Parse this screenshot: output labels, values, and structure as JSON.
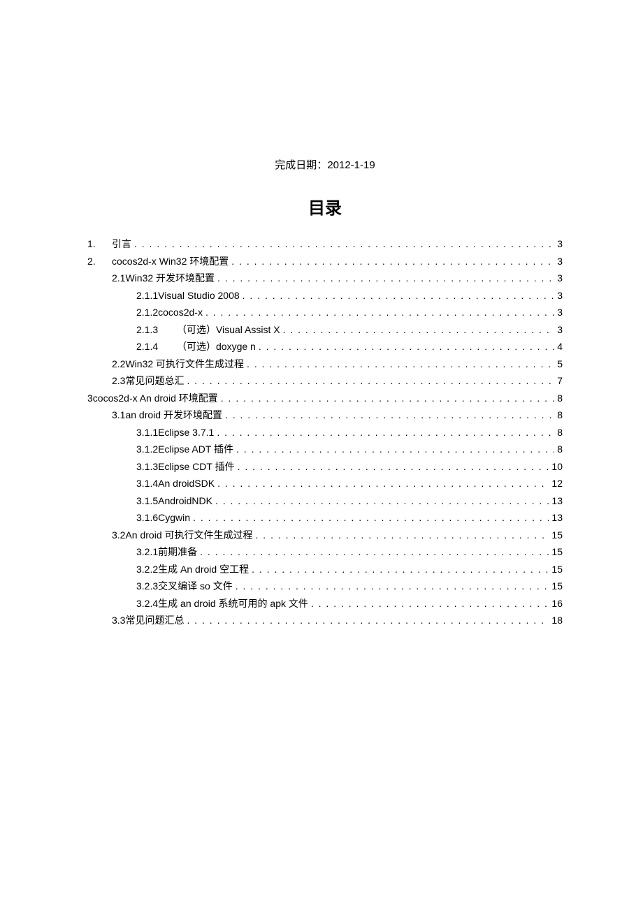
{
  "header": {
    "completion_label": "完成日期：",
    "completion_date": "2012-1-19"
  },
  "toc": {
    "title": "目录",
    "entries": [
      {
        "level": 0,
        "num": "1.",
        "title": "引言",
        "page": "3",
        "num_style": "col"
      },
      {
        "level": 0,
        "num": "2.",
        "title": "cocos2d-x Win32 环境配置",
        "page": "3",
        "num_style": "col"
      },
      {
        "level": 1,
        "num": "2.1",
        "title": " Win32 开发环境配置",
        "page": "3",
        "num_style": "plain"
      },
      {
        "level": 2,
        "num": "2.1.1",
        "title": " Visual Studio 2008",
        "page": " 3",
        "num_style": "plain"
      },
      {
        "level": 2,
        "num": "2.1.2",
        "title": "  cocos2d-x",
        "page": " 3",
        "num_style": "plain"
      },
      {
        "level": 2,
        "num": "2.1.3",
        "title": "（可选）Visual Assist X",
        "page": " 3",
        "num_style": "spaced"
      },
      {
        "level": 2,
        "num": "2.1.4",
        "title": "（可选）doxyge n",
        "page": " 4",
        "num_style": "spaced"
      },
      {
        "level": 1,
        "num": "2.2",
        "title": "  Win32 可执行文件生成过程",
        "page": "5",
        "num_style": "plain"
      },
      {
        "level": 1,
        "num": "2.3",
        "title": " 常见问题总汇",
        "page": "7",
        "num_style": "plain"
      },
      {
        "level": 0,
        "num": "3",
        "title": " cocos2d-x An droid 环境配置",
        "page": "8",
        "num_style": "plain"
      },
      {
        "level": 1,
        "num": "3.1",
        "title": " an droid 开发环境配置",
        "page": "8",
        "num_style": "plain"
      },
      {
        "level": 2,
        "num": "3.1.1",
        "title": " Eclipse 3.7.1",
        "page": " 8",
        "num_style": "plain"
      },
      {
        "level": 2,
        "num": "3.1.2",
        "title": " Eclipse ADT  插件",
        "page": "8",
        "num_style": "plain"
      },
      {
        "level": 2,
        "num": "3.1.3",
        "title": " Eclipse CDT  插件",
        "page": " 10",
        "num_style": "plain"
      },
      {
        "level": 2,
        "num": "3.1.4",
        "title": " An droidSDK",
        "page": " 12",
        "num_style": "plain"
      },
      {
        "level": 2,
        "num": "3.1.5",
        "title": " AndroidNDK",
        "page": " 13",
        "num_style": "plain"
      },
      {
        "level": 2,
        "num": "3.1.6",
        "title": " Cygwin",
        "page": " 13",
        "num_style": "plain"
      },
      {
        "level": 1,
        "num": "3.2",
        "title": "  An droid 可执行文件生成过程",
        "page": "15",
        "num_style": "plain"
      },
      {
        "level": 2,
        "num": "3.2.1",
        "title": " 前期准备",
        "page": "15",
        "num_style": "plain"
      },
      {
        "level": 2,
        "num": "3.2.2",
        "title": " 生成 An droid 空工程",
        "page": "15",
        "num_style": "plain"
      },
      {
        "level": 2,
        "num": "3.2.3",
        "title": " 交叉编译  so 文件",
        "page": " 15",
        "num_style": "plain"
      },
      {
        "level": 2,
        "num": "3.2.4",
        "title": " 生成 an droid 系统可用的  apk 文件",
        "page": "16",
        "num_style": "plain"
      },
      {
        "level": 1,
        "num": "3.3",
        "title": "  常见问题汇总",
        "page": "18",
        "num_style": "plain"
      }
    ]
  }
}
